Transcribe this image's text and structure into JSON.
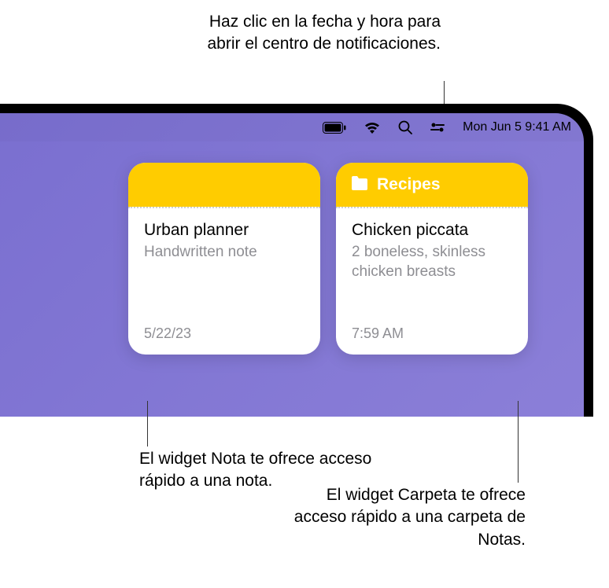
{
  "callouts": {
    "top": "Haz clic en la fecha y hora para abrir el centro de notificaciones.",
    "bottom_left": "El widget Nota te ofrece acceso rápido a una nota.",
    "bottom_right": "El widget Carpeta te ofrece acceso rápido a una carpeta de Notas."
  },
  "menubar": {
    "datetime": "Mon Jun 5  9:41 AM"
  },
  "widgets": [
    {
      "header_title": "",
      "title": "Urban planner",
      "subtitle": "Handwritten note",
      "footer": "5/22/23",
      "has_folder_icon": false
    },
    {
      "header_title": "Recipes",
      "title": "Chicken piccata",
      "subtitle": "2 boneless, skinless chicken breasts",
      "footer": "7:59 AM",
      "has_folder_icon": true
    }
  ]
}
